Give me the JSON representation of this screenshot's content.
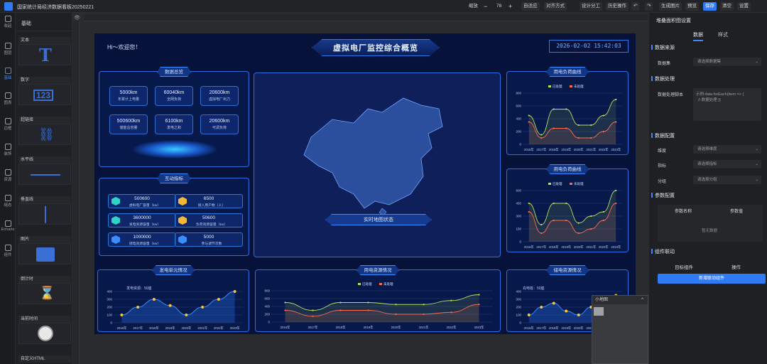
{
  "window": {
    "title": "国家统计局经济数据看板20250221"
  },
  "toolbar": {
    "zoom_label": "缩放",
    "zoom_value": "78",
    "minus": "−",
    "plus": "+",
    "fit": "自适应",
    "align": "对齐方式",
    "design": "设计分工",
    "history": "历史操作",
    "undo": "↶",
    "redo": "↷",
    "gen_image": "生成图片",
    "preview": "预览",
    "save": "保存",
    "clear": "清空",
    "settings": "设置"
  },
  "leftnav": {
    "items": [
      {
        "label": "收起"
      },
      {
        "label": "图层"
      },
      {
        "label": "基础"
      },
      {
        "label": "图表"
      },
      {
        "label": "边框"
      },
      {
        "label": "装饰"
      },
      {
        "label": "资源"
      },
      {
        "label": "组态"
      },
      {
        "label": "Echarts"
      },
      {
        "label": "组件"
      }
    ]
  },
  "palette": {
    "header": "基础",
    "items": [
      {
        "label": "文本",
        "glyph": "T"
      },
      {
        "label": "数字",
        "glyph": "123"
      },
      {
        "label": "超链接",
        "glyph": "⛓"
      },
      {
        "label": "水平线",
        "glyph": ""
      },
      {
        "label": "垂直线",
        "glyph": ""
      },
      {
        "label": "图片",
        "glyph": ""
      },
      {
        "label": "倒计时",
        "glyph": "⌛"
      },
      {
        "label": "当前时间",
        "glyph": "🕒"
      },
      {
        "label": "自定义HTML",
        "glyph": ""
      }
    ]
  },
  "dashboard": {
    "greeting": "Hi～欢迎您！",
    "title": "虚拟电厂监控综合概览",
    "datetime": "2026-02-02  15:42:03",
    "overview": {
      "title": "数据总览",
      "stats": [
        {
          "value": "5000km",
          "label": "年累计上电量"
        },
        {
          "value": "60040km",
          "label": "全网负荷"
        },
        {
          "value": "20600km",
          "label": "虚拟电厂出力"
        },
        {
          "value": "500600km",
          "label": "储能总容量"
        },
        {
          "value": "6100km",
          "label": "发电之和"
        },
        {
          "value": "20600km",
          "label": "可调负荷"
        }
      ]
    },
    "interaction": {
      "title": "互动指标",
      "items": [
        {
          "value": "500600",
          "label": "虚拟电厂容量（kw）",
          "color": "#2fd3c7"
        },
        {
          "value": "6500",
          "label": "接入用户数（人）",
          "color": "#f5b93a"
        },
        {
          "value": "3600000",
          "label": "发电资源容量（kw）",
          "color": "#2fd3c7"
        },
        {
          "value": "50600",
          "label": "负荷资源容量（kw）",
          "color": "#f5b93a"
        },
        {
          "value": "1000000",
          "label": "储电资源容量（kw）",
          "color": "#3a8cff"
        },
        {
          "value": "5000",
          "label": "参与调节次数",
          "color": "#3a8cff"
        }
      ]
    },
    "map": {
      "button": "实时地图状态"
    },
    "load1": {
      "title": "用电负荷曲线"
    },
    "load2": {
      "title": "用电负荷曲线"
    },
    "gen": {
      "title": "发电单元情况",
      "note": "发电资源：50座"
    },
    "usage": {
      "title": "用电资源情况"
    },
    "storage": {
      "title": "储电资源情况",
      "note": "充电桩：50座"
    }
  },
  "chart_data": [
    {
      "type": "line",
      "title": "用电负荷曲线",
      "x": [
        "2016年",
        "2017年",
        "2018年",
        "2019年",
        "2020年",
        "2021年",
        "2022年",
        "2023年"
      ],
      "series": [
        {
          "name": "已处理",
          "values": [
            450,
            150,
            550,
            550,
            300,
            300,
            450,
            700
          ]
        },
        {
          "name": "未处理",
          "values": [
            350,
            100,
            250,
            250,
            100,
            100,
            200,
            350
          ]
        }
      ],
      "ylim": [
        0,
        800
      ],
      "legend": "top"
    },
    {
      "type": "line",
      "title": "用电负荷曲线",
      "x": [
        "2016年",
        "2017年",
        "2018年",
        "2019年",
        "2020年",
        "2021年",
        "2022年",
        "2023年"
      ],
      "series": [
        {
          "name": "已处理",
          "values": [
            450,
            200,
            450,
            450,
            220,
            300,
            350,
            600
          ]
        },
        {
          "name": "未处理",
          "values": [
            350,
            100,
            250,
            250,
            100,
            150,
            250,
            450
          ]
        }
      ],
      "ylim": [
        0,
        600
      ],
      "legend": "top"
    },
    {
      "type": "area",
      "title": "发电单元情况",
      "x": [
        "2016年",
        "2017年",
        "2018年",
        "2019年",
        "2020年",
        "2021年",
        "2022年",
        "2023年"
      ],
      "series": [
        {
          "values": [
            100,
            200,
            300,
            220,
            100,
            200,
            300,
            400
          ]
        }
      ],
      "ylim": [
        0,
        400
      ]
    },
    {
      "type": "line",
      "title": "用电资源情况",
      "x": [
        "2016年",
        "2017年",
        "2018年",
        "2019年",
        "2020年",
        "2021年",
        "2022年",
        "2023年"
      ],
      "series": [
        {
          "name": "已处理",
          "values": [
            500,
            300,
            500,
            500,
            450,
            450,
            550,
            700
          ]
        },
        {
          "name": "未处理",
          "values": [
            300,
            150,
            300,
            300,
            200,
            200,
            250,
            450
          ]
        }
      ],
      "ylim": [
        0,
        800
      ],
      "legend": "top"
    },
    {
      "type": "area",
      "title": "储电资源情况",
      "x": [
        "2016年",
        "2017年",
        "2018年",
        "2019年",
        "2020年",
        "2021年",
        "2022年",
        "2023年"
      ],
      "series": [
        {
          "values": [
            100,
            200,
            250,
            150,
            100,
            200,
            280,
            350
          ]
        }
      ],
      "ylim": [
        0,
        400
      ]
    }
  ],
  "rightpanel": {
    "title": "堆叠面积图设置",
    "tab_data": "数据",
    "tab_style": "样式",
    "sec_source": "数据来源",
    "dataset_label": "数据集",
    "dataset_placeholder": "请选择数据集",
    "sec_process": "数据处理",
    "script_label": "数据处理脚本",
    "script_text": "示例:data.forEach(item => {\n  // 数据处理 }}",
    "sec_config": "数据配置",
    "dim_label": "维度",
    "dim_placeholder": "请选择维度",
    "metric_label": "指标",
    "metric_placeholder": "请选择指标",
    "group_label": "分组",
    "group_placeholder": "请选择分组",
    "sec_params": "参数配置",
    "param_name": "参数名称",
    "param_value": "参数值",
    "no_data": "暂无数据",
    "sec_link": "组件联动",
    "target": "目标组件",
    "op": "操作",
    "add_link": "新增联动组件"
  },
  "minimap": {
    "title": "小地图",
    "toggle": "^"
  }
}
